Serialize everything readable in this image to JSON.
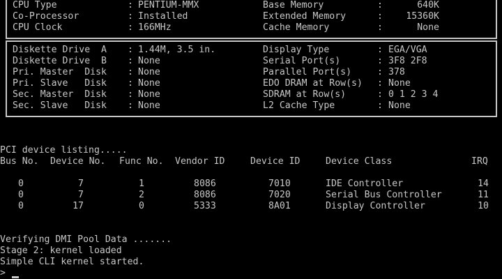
{
  "sysinfo": {
    "top_left": [
      {
        "label": "CPU Type",
        "value": "PENTIUM-MMX"
      },
      {
        "label": "Co-Processor",
        "value": "Installed"
      },
      {
        "label": "CPU Clock",
        "value": "166MHz"
      }
    ],
    "top_right": [
      {
        "label": "Base Memory",
        "value": "640K"
      },
      {
        "label": "Extended Memory",
        "value": "15360K"
      },
      {
        "label": "Cache Memory",
        "value": "None"
      }
    ],
    "bottom_left": [
      {
        "label": "Diskette Drive  A",
        "value": "1.44M, 3.5 in."
      },
      {
        "label": "Diskette Drive  B",
        "value": "None"
      },
      {
        "label": "Pri. Master  Disk",
        "value": "None"
      },
      {
        "label": "Pri. Slave   Disk",
        "value": "None"
      },
      {
        "label": "Sec. Master  Disk",
        "value": "None"
      },
      {
        "label": "Sec. Slave   Disk",
        "value": "None"
      }
    ],
    "bottom_right": [
      {
        "label": "Display Type",
        "value": "EGA/VGA"
      },
      {
        "label": "Serial Port(s)",
        "value": "3F8 2F8"
      },
      {
        "label": "Parallel Port(s)",
        "value": "378"
      },
      {
        "label": "EDO DRAM at Row(s)",
        "value": "None"
      },
      {
        "label": "SDRAM at Row(s)",
        "value": "0 1 2 3 4"
      },
      {
        "label": "L2 Cache Type",
        "value": "None"
      }
    ]
  },
  "pci": {
    "title": "PCI device listing.....",
    "headers": [
      "Bus No.",
      "Device No.",
      "Func No.",
      "Vendor ID",
      "Device ID",
      "Device Class",
      "IRQ"
    ],
    "rows": [
      [
        "0",
        "7",
        "1",
        "8086",
        "7010",
        "IDE Controller",
        "14"
      ],
      [
        "0",
        "7",
        "2",
        "8086",
        "7020",
        "Serial Bus Controller",
        "11"
      ],
      [
        "0",
        "17",
        "0",
        "5333",
        "8A01",
        "Display Controller",
        "10"
      ]
    ]
  },
  "console": {
    "lines": [
      "Verifying DMI Pool Data .......",
      "Stage 2: kernel loaded",
      "Simple CLI kernel started."
    ],
    "prompt": ">"
  }
}
